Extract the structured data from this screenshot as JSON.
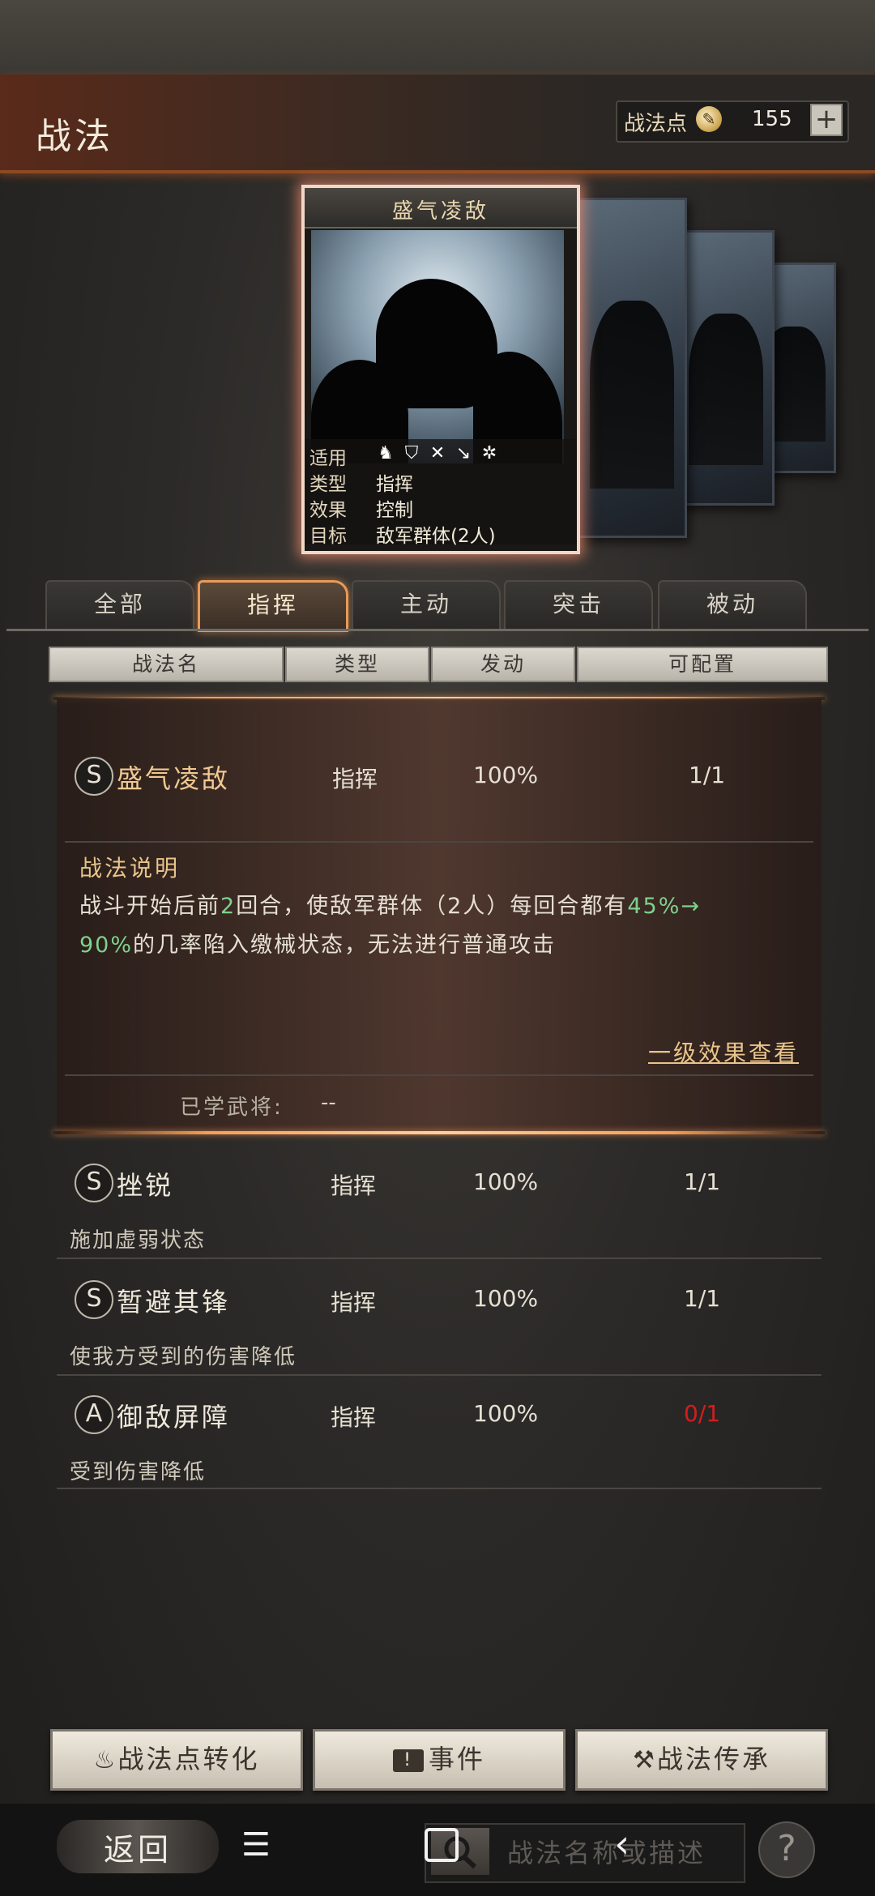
{
  "header": {
    "title": "战法",
    "points_label": "战法点",
    "points_value": "155",
    "plus": "+"
  },
  "featured_card": {
    "name": "盛气凌敌",
    "labels": {
      "apply": "适用",
      "type": "类型",
      "effect": "效果",
      "target": "目标"
    },
    "type": "指挥",
    "effect": "控制",
    "target": "敌军群体(2人)",
    "weapon_icons": [
      "cavalry-icon",
      "shield-icon",
      "archer-icon",
      "spear-icon",
      "siege-icon"
    ]
  },
  "tabs": [
    "全部",
    "指挥",
    "主动",
    "突击",
    "被动"
  ],
  "active_tab": "指挥",
  "columns": [
    "战法名",
    "类型",
    "发动",
    "可配置"
  ],
  "expanded_skill": {
    "grade": "S",
    "name": "盛气凌敌",
    "type": "指挥",
    "rate": "100%",
    "config": "1/1",
    "desc_title": "战法说明",
    "desc_line1_a": "战斗开始后前",
    "desc_line1_b": "2",
    "desc_line1_c": "回合，使敌军群体（2人）每回合都有",
    "desc_line1_d": "45%→",
    "desc_line2_a": "90%",
    "desc_line2_b": "的几率陷入缴械状态，无法进行普通攻击",
    "level_link": "一级效果查看",
    "learned_label": "已学武将:",
    "learned_value": "--"
  },
  "skills": [
    {
      "grade": "S",
      "name": "挫锐",
      "type": "指挥",
      "rate": "100%",
      "config": "1/1",
      "desc": "施加虚弱状态"
    },
    {
      "grade": "S",
      "name": "暂避其锋",
      "type": "指挥",
      "rate": "100%",
      "config": "1/1",
      "desc": "使我方受到的伤害降低"
    },
    {
      "grade": "A",
      "name": "御敌屏障",
      "type": "指挥",
      "rate": "100%",
      "config": "0/1",
      "desc": "受到伤害降低"
    }
  ],
  "colors": {
    "config_zero": "#d21e1e",
    "highlight_green": "#7fd18c",
    "gold": "#e9c48a"
  },
  "buttons": {
    "convert": "战法点转化",
    "event": "事件",
    "inherit": "战法传承"
  },
  "bottom": {
    "back": "返回",
    "menu": "☰",
    "search_placeholder": "战法名称或描述",
    "help": "?"
  }
}
